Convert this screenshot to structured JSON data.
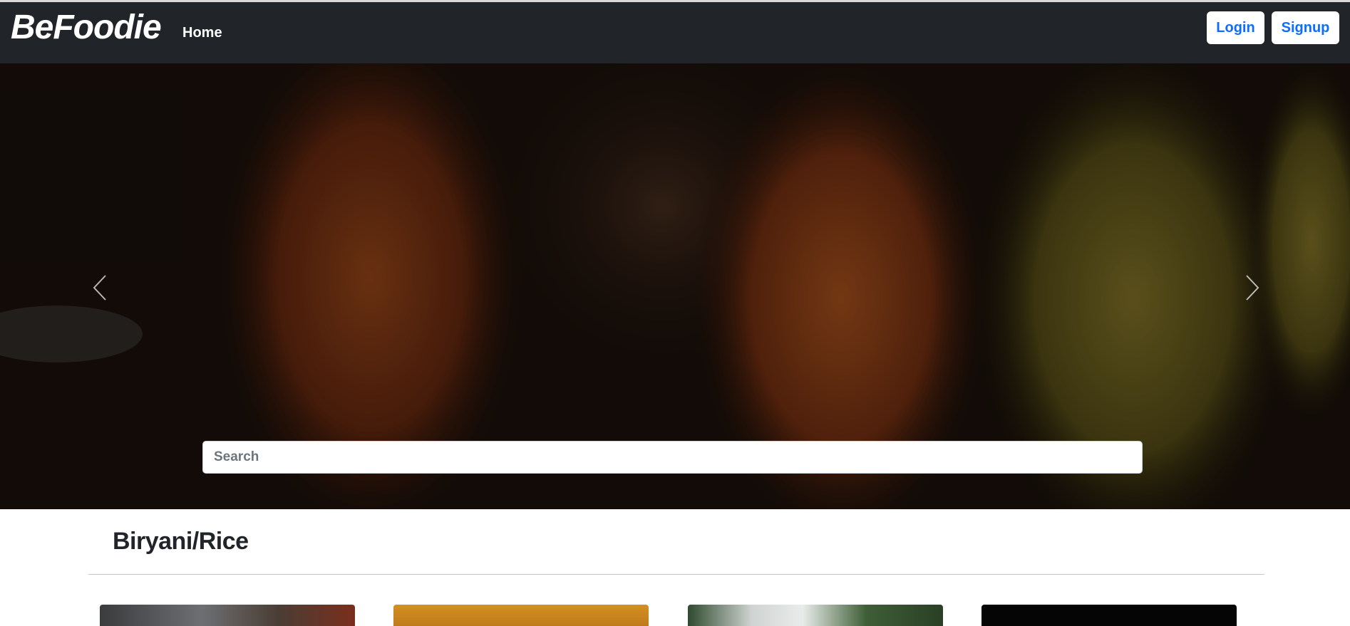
{
  "navbar": {
    "brand": "BeFoodie",
    "home_link": "Home",
    "login_label": "Login",
    "signup_label": "Signup"
  },
  "hero": {
    "search_placeholder": "Search",
    "prev_icon": "chevron-left-icon",
    "next_icon": "chevron-right-icon"
  },
  "category": {
    "title": "Biryani/Rice",
    "cards": [
      {
        "image": "biryani-dish-image"
      },
      {
        "image": "rice-dish-image"
      },
      {
        "image": "rice-bowl-image"
      },
      {
        "image": "dark-dish-image"
      }
    ]
  },
  "colors": {
    "navbar_bg": "#212529",
    "accent_blue": "#0d6efd",
    "button_bg": "#ffffff"
  }
}
